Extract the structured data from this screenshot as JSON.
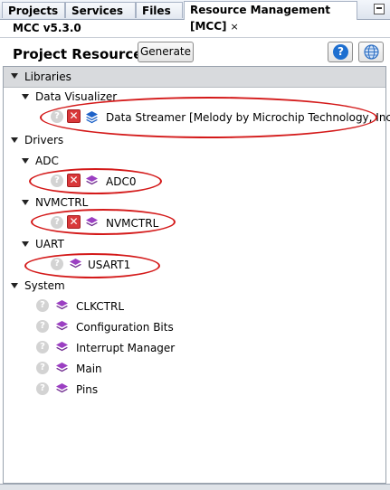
{
  "tabs": [
    {
      "label": "Projects"
    },
    {
      "label": "Services"
    },
    {
      "label": "Files"
    },
    {
      "label": "Resource Management [MCC]",
      "close": "×"
    }
  ],
  "version": "MCC v5.3.0",
  "header": {
    "title": "Project Resources",
    "generate_label": "Generate",
    "help_label": "?"
  },
  "tree": {
    "root": "Libraries",
    "data_visualizer": "Data Visualizer",
    "data_streamer": "Data Streamer [Melody by Microchip Technology, Inc.]",
    "drivers": "Drivers",
    "adc": "ADC",
    "adc0": "ADC0",
    "nvmctrl_group": "NVMCTRL",
    "nvmctrl": "NVMCTRL",
    "uart": "UART",
    "usart1": "USART1",
    "system": "System",
    "system_items": [
      "CLKCTRL",
      "Configuration Bits",
      "Interrupt Manager",
      "Main",
      "Pins"
    ]
  },
  "icons": {
    "help_glyph": "?",
    "remove_glyph": "✕",
    "colors": {
      "remove_red": "#d9383a",
      "layers_purple": "#9b3fc2",
      "layers_blue": "#1e62c8",
      "annotation_red": "#d41a1a",
      "help_blue": "#1e6fd0"
    }
  }
}
